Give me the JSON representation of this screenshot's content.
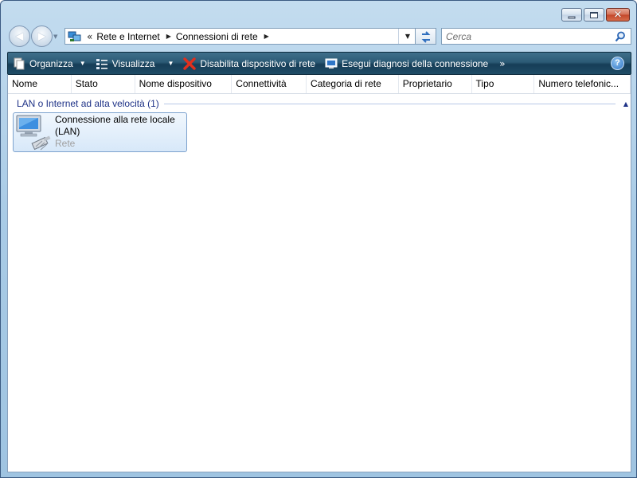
{
  "address": {
    "overflow": "«",
    "breadcrumbs": [
      "Rete e Internet",
      "Connessioni di rete"
    ]
  },
  "search": {
    "placeholder": "Cerca"
  },
  "toolbar": {
    "organize": "Organizza",
    "views": "Visualizza",
    "disable": "Disabilita dispositivo di rete",
    "diagnose": "Esegui diagnosi della connessione",
    "more": "»",
    "help": "?"
  },
  "columns": [
    "Nome",
    "Stato",
    "Nome dispositivo",
    "Connettività",
    "Categoria di rete",
    "Proprietario",
    "Tipo",
    "Numero telefonic..."
  ],
  "group": {
    "title": "LAN o Internet ad alta velocità (1)"
  },
  "items": [
    {
      "name": "Connessione alla rete locale (LAN)",
      "status": "Rete"
    }
  ],
  "colors": {
    "command_bar": "#1f4c66",
    "group_title": "#1e3287",
    "selection": "#d7e8f9"
  }
}
